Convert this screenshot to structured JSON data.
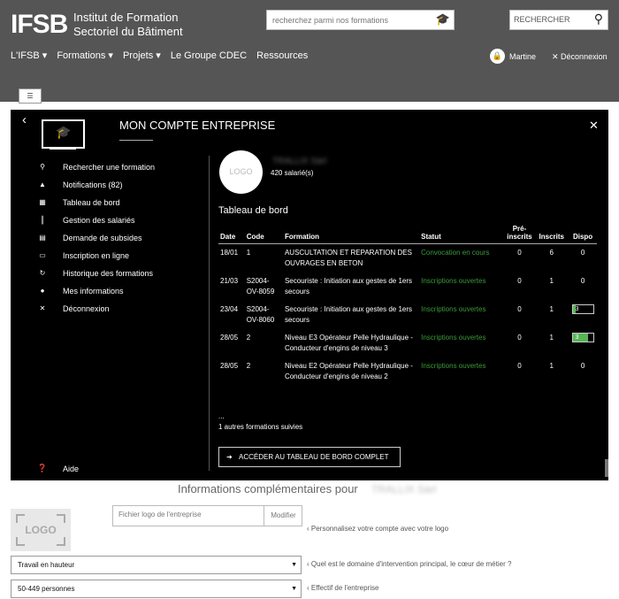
{
  "header": {
    "logo": "IFSB",
    "org_line1": "Institut de Formation",
    "org_line2": "Sectoriel du Bâtiment",
    "search_placeholder": "recherchez parmi nos formations",
    "rechercher": "RECHERCHER",
    "nav": [
      "L'IFSB ▾",
      "Formations ▾",
      "Projets ▾",
      "Le Groupe CDEC",
      "Ressources"
    ],
    "user_name": "Martine",
    "logout": "Déconnexion"
  },
  "panel": {
    "title": "MON COMPTE ENTREPRISE",
    "menu": [
      {
        "icon": "search-icon",
        "glyph": "⚲",
        "label": "Rechercher une formation"
      },
      {
        "icon": "bell-icon",
        "glyph": "▲",
        "label": "Notifications (82)"
      },
      {
        "icon": "grid-icon",
        "glyph": "▦",
        "label": "Tableau de bord"
      },
      {
        "icon": "barcode-icon",
        "glyph": "║",
        "label": "Gestion des salariés"
      },
      {
        "icon": "calendar-icon",
        "glyph": "▤",
        "label": "Demande de subsides"
      },
      {
        "icon": "laptop-icon",
        "glyph": "▭",
        "label": "Inscription en ligne"
      },
      {
        "icon": "history-icon",
        "glyph": "↻",
        "label": "Historique des formations"
      },
      {
        "icon": "user-icon",
        "glyph": "●",
        "label": "Mes informations"
      },
      {
        "icon": "close-icon",
        "glyph": "✕",
        "label": "Déconnexion"
      }
    ],
    "aide": "Aide",
    "logo_circle": "LOGO",
    "company_name": "TRALLIX Sàrl",
    "employees": "420 salarié(s)",
    "dashboard_title": "Tableau de bord",
    "columns": [
      "Date",
      "Code",
      "Formation",
      "Statut",
      "Pré-inscrits",
      "Inscrits",
      "Dispo"
    ],
    "rows": [
      {
        "date": "18/01",
        "code": "1",
        "formation": "AUSCULTATION ET REPARATION DES OUVRAGES EN BETON",
        "statut": "Convocation en cours",
        "pre": "0",
        "ins": "6",
        "dispo": "0",
        "dispo_fraction": null
      },
      {
        "date": "21/03",
        "code": "S2004-OV-8059",
        "formation": "Secouriste : Initiation aux gestes de 1ers secours",
        "statut": "Inscriptions ouvertes",
        "pre": "0",
        "ins": "1",
        "dispo": "0",
        "dispo_fraction": null
      },
      {
        "date": "23/04",
        "code": "S2004-OV-8060",
        "formation": "Secouriste : Initiation aux gestes de 1ers secours",
        "statut": "Inscriptions ouvertes",
        "pre": "0",
        "ins": "1",
        "dispo": "3",
        "dispo_fraction": 0.15
      },
      {
        "date": "28/05",
        "code": "2",
        "formation": "Niveau E3 Opérateur Pelle Hydraulique - Conducteur d'engins de niveau 3",
        "statut": "Inscriptions ouvertes",
        "pre": "0",
        "ins": "1",
        "dispo": "3",
        "dispo_fraction": 0.75
      },
      {
        "date": "28/05",
        "code": "2",
        "formation": "Niveau E2 Opérateur Pelle Hydraulique - Conducteur d'engins de niveau 2",
        "statut": "Inscriptions ouvertes",
        "pre": "0",
        "ins": "1",
        "dispo": "0",
        "dispo_fraction": null
      }
    ],
    "ellipsis": "...",
    "autres": "1 autres formations suivies",
    "acceder": "ACCÉDER AU TABLEAU DE BORD COMPLET"
  },
  "info": {
    "title": "Informations complémentaires pour",
    "company_blur": "TRALLIX Sàrl",
    "logo_label": "LOGO",
    "file_placeholder": "Fichier logo de l'entreprise",
    "modifier": "Modifier",
    "hint_logo": "Personnalisez votre compte avec votre logo",
    "domain_value": "Travail en hauteur",
    "hint_domain": "Quel est le domaine d'intervention principal, le cœur de métier ?",
    "size_value": "50-449 personnes",
    "hint_size": "Effectif de l'entreprise"
  },
  "colors": {
    "header_bg": "#555555",
    "panel_bg": "#000000",
    "status_green": "#3a9a3a",
    "dispo_green": "#55b655"
  }
}
